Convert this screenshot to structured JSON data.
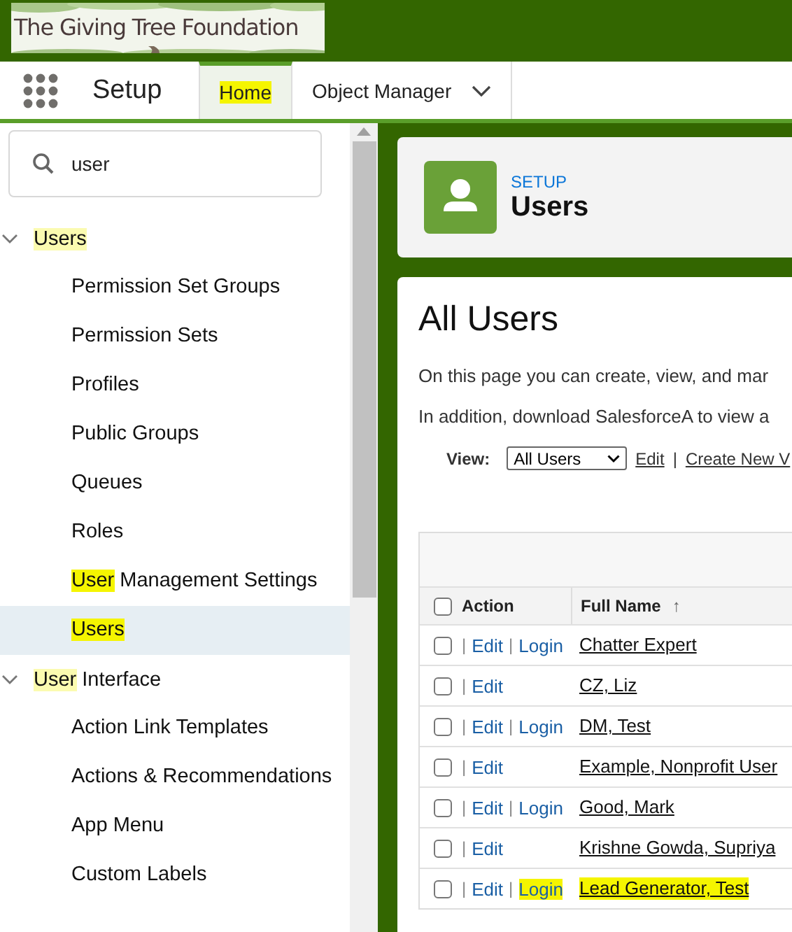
{
  "logo": {
    "text": "The Giving Tree Foundation"
  },
  "nav": {
    "title": "Setup",
    "tabs": [
      {
        "label": "Home",
        "selected": true,
        "highlighted": true,
        "dropdown": false
      },
      {
        "label": "Object Manager",
        "selected": false,
        "highlighted": false,
        "dropdown": true
      }
    ]
  },
  "sidebar": {
    "search": {
      "value": "user"
    },
    "tree": [
      {
        "parts": [
          {
            "text": "Users",
            "highlighted": true,
            "color": "#fbfbb0"
          }
        ],
        "expanded": true,
        "selected": false,
        "children": [
          {
            "parts": [
              {
                "text": "Permission Set Groups",
                "highlighted": false
              }
            ],
            "selected": false
          },
          {
            "parts": [
              {
                "text": "Permission Sets",
                "highlighted": false
              }
            ],
            "selected": false
          },
          {
            "parts": [
              {
                "text": "Profiles",
                "highlighted": false
              }
            ],
            "selected": false
          },
          {
            "parts": [
              {
                "text": "Public Groups",
                "highlighted": false
              }
            ],
            "selected": false
          },
          {
            "parts": [
              {
                "text": "Queues",
                "highlighted": false
              }
            ],
            "selected": false
          },
          {
            "parts": [
              {
                "text": "Roles",
                "highlighted": false
              }
            ],
            "selected": false
          },
          {
            "parts": [
              {
                "text": "User",
                "highlighted": true,
                "color": "#f5f500"
              },
              {
                "text": " Management Settings",
                "highlighted": false
              }
            ],
            "selected": false
          },
          {
            "parts": [
              {
                "text": "Users",
                "highlighted": true,
                "color": "#f5f500"
              }
            ],
            "selected": true
          }
        ]
      },
      {
        "parts": [
          {
            "text": "User",
            "highlighted": true,
            "color": "#fbfbb0"
          },
          {
            "text": " Interface",
            "highlighted": false
          }
        ],
        "expanded": true,
        "selected": false,
        "children": [
          {
            "parts": [
              {
                "text": "Action Link Templates",
                "highlighted": false
              }
            ],
            "selected": false
          },
          {
            "parts": [
              {
                "text": "Actions & Recommendations",
                "highlighted": false
              }
            ],
            "selected": false
          },
          {
            "parts": [
              {
                "text": "App Menu",
                "highlighted": false
              }
            ],
            "selected": false
          },
          {
            "parts": [
              {
                "text": "Custom Labels",
                "highlighted": false
              }
            ],
            "selected": false
          }
        ]
      }
    ]
  },
  "page_header": {
    "eyebrow": "SETUP",
    "title": "Users"
  },
  "content": {
    "title": "All Users",
    "paragraphs": [
      "On this page you can create, view, and mar",
      "In addition, download SalesforceA to view a"
    ],
    "view": {
      "label": "View:",
      "value": "All Users",
      "links": [
        "Edit",
        "Create New V"
      ],
      "separator": "|"
    },
    "table": {
      "columns": [
        "Action",
        "Full Name"
      ],
      "sort_indicator": "↑",
      "select_all_checked": false,
      "separator": "|",
      "rows": [
        {
          "checked": false,
          "login": true,
          "edit_label": "Edit",
          "login_label": "Login",
          "name": "Chatter Expert",
          "highlighted": false
        },
        {
          "checked": false,
          "login": false,
          "edit_label": "Edit",
          "name": "CZ, Liz",
          "highlighted": false
        },
        {
          "checked": false,
          "login": true,
          "edit_label": "Edit",
          "login_label": "Login",
          "name": "DM, Test",
          "highlighted": false
        },
        {
          "checked": false,
          "login": false,
          "edit_label": "Edit",
          "name": "Example, Nonprofit User",
          "highlighted": false
        },
        {
          "checked": false,
          "login": true,
          "edit_label": "Edit",
          "login_label": "Login",
          "name": "Good, Mark",
          "highlighted": false
        },
        {
          "checked": false,
          "login": false,
          "edit_label": "Edit",
          "name": "Krishne Gowda, Supriya",
          "highlighted": false
        },
        {
          "checked": false,
          "login": true,
          "edit_label": "Edit",
          "login_label": "Login",
          "name": "Lead Generator, Test",
          "highlighted": true
        }
      ]
    }
  }
}
